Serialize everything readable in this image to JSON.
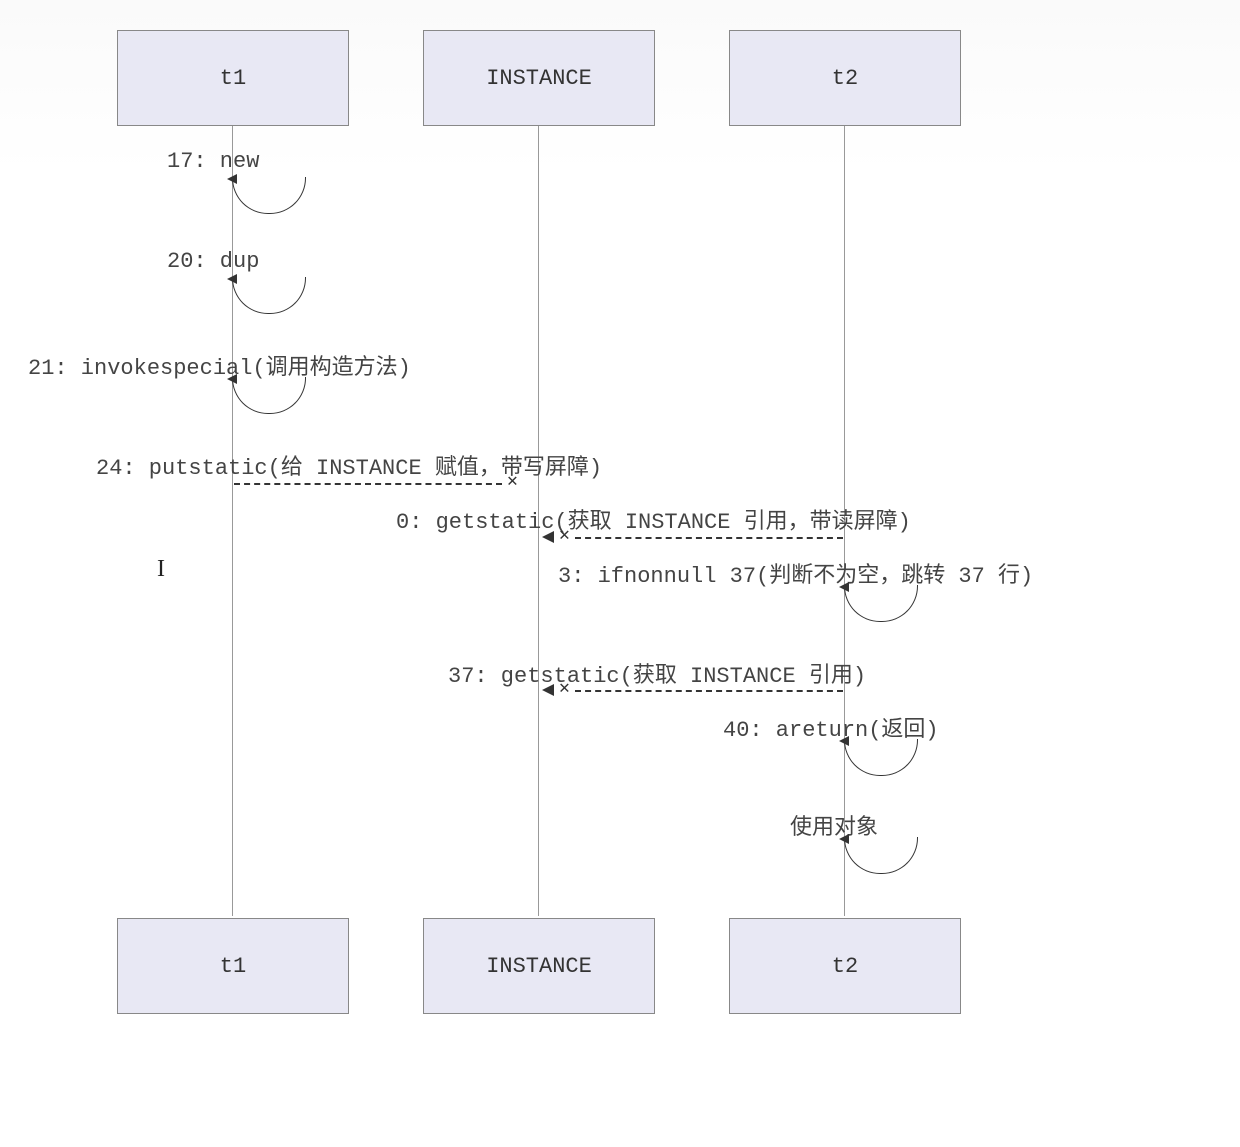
{
  "actors": {
    "t1": "t1",
    "instance": "INSTANCE",
    "t2": "t2"
  },
  "messages": {
    "m1": "17: new",
    "m2": "20: dup",
    "m3": "21: invokespecial(调用构造方法)",
    "m4": "24: putstatic(给 INSTANCE 赋值，带写屏障)",
    "m5": "0: getstatic(获取 INSTANCE 引用，带读屏障)",
    "m6": "3: ifnonnull 37(判断不为空，跳转 37 行)",
    "m7": "37: getstatic(获取 INSTANCE 引用)",
    "m8": "40: areturn(返回)",
    "m9": "使用对象"
  },
  "chart_data": {
    "type": "sequence_diagram",
    "participants": [
      "t1",
      "INSTANCE",
      "t2"
    ],
    "steps": [
      {
        "from": "t1",
        "to": "t1",
        "label": "17: new",
        "kind": "self"
      },
      {
        "from": "t1",
        "to": "t1",
        "label": "20: dup",
        "kind": "self"
      },
      {
        "from": "t1",
        "to": "t1",
        "label": "21: invokespecial(调用构造方法)",
        "kind": "self"
      },
      {
        "from": "t1",
        "to": "INSTANCE",
        "label": "24: putstatic(给 INSTANCE 赋值，带写屏障)",
        "kind": "dashed-blocked"
      },
      {
        "from": "t2",
        "to": "INSTANCE",
        "label": "0: getstatic(获取 INSTANCE 引用，带读屏障)",
        "kind": "dashed-blocked"
      },
      {
        "from": "t2",
        "to": "t2",
        "label": "3: ifnonnull 37(判断不为空，跳转 37 行)",
        "kind": "self"
      },
      {
        "from": "t2",
        "to": "INSTANCE",
        "label": "37: getstatic(获取 INSTANCE 引用)",
        "kind": "dashed-blocked"
      },
      {
        "from": "t2",
        "to": "t2",
        "label": "40: areturn(返回)",
        "kind": "self"
      },
      {
        "from": "t2",
        "to": "t2",
        "label": "使用对象",
        "kind": "self"
      }
    ]
  }
}
